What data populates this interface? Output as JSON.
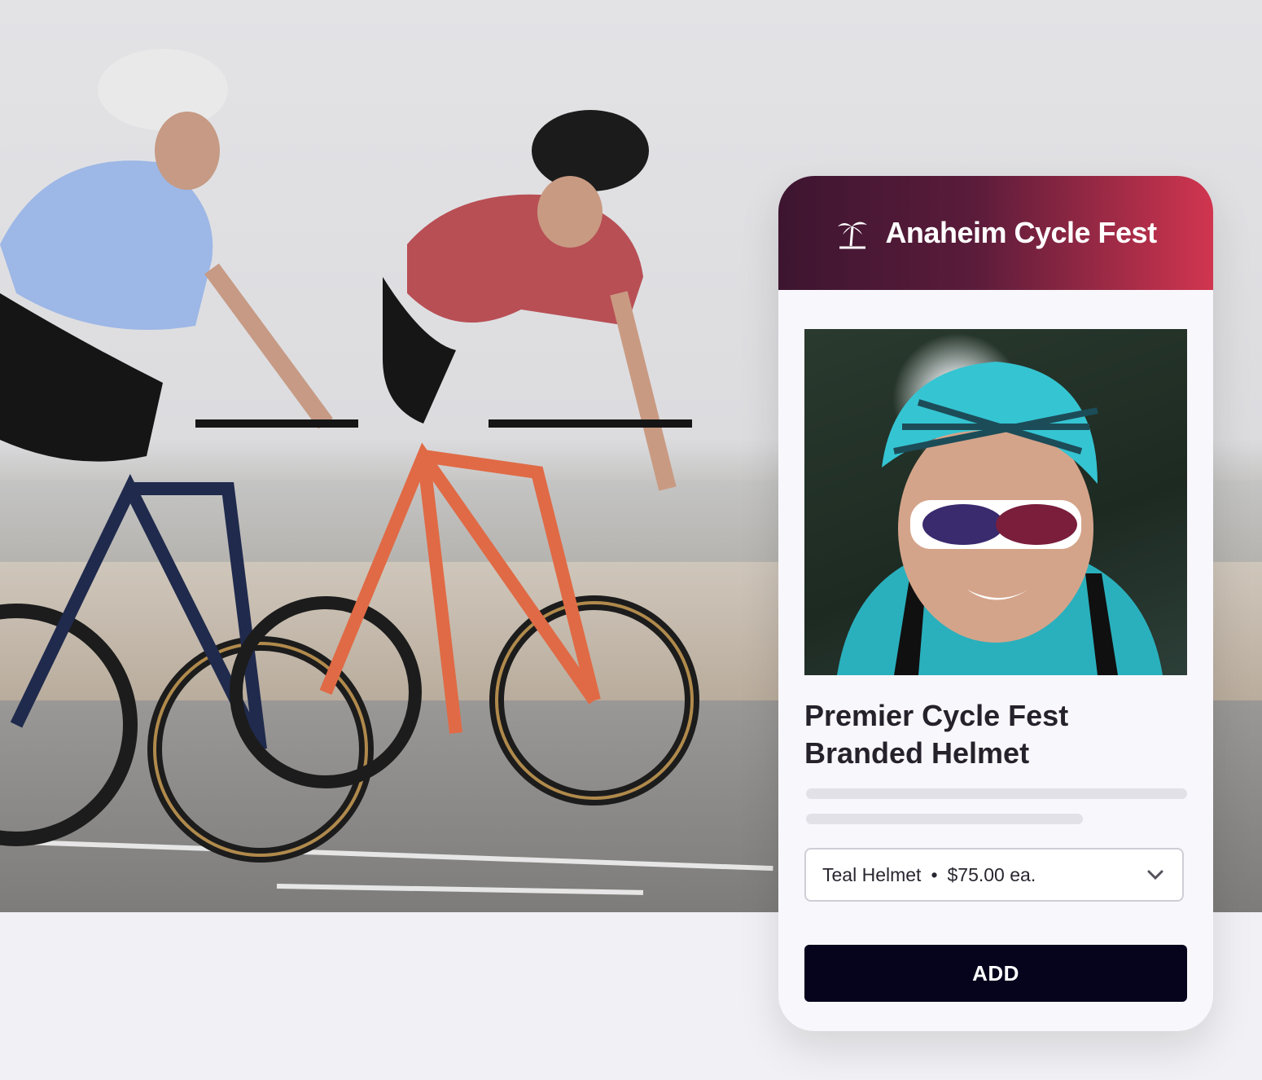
{
  "card": {
    "event_title": "Anaheim Cycle Fest",
    "event_icon": "palm-tree-icon",
    "product_image": "cyclist-teal-helmet-photo",
    "product_title": "Premier Cycle Fest\nBranded Helmet",
    "variant": {
      "name": "Teal Helmet",
      "separator": "•",
      "price": "$75.00 ea."
    },
    "add_label": "ADD"
  },
  "hero": {
    "image": "two-cyclists-riding-road-bikes-photo"
  },
  "colors": {
    "header_gradient_start": "#3d1530",
    "header_gradient_end": "#d1354f",
    "button": "#06041d",
    "page_bg": "#f1f1f5"
  }
}
